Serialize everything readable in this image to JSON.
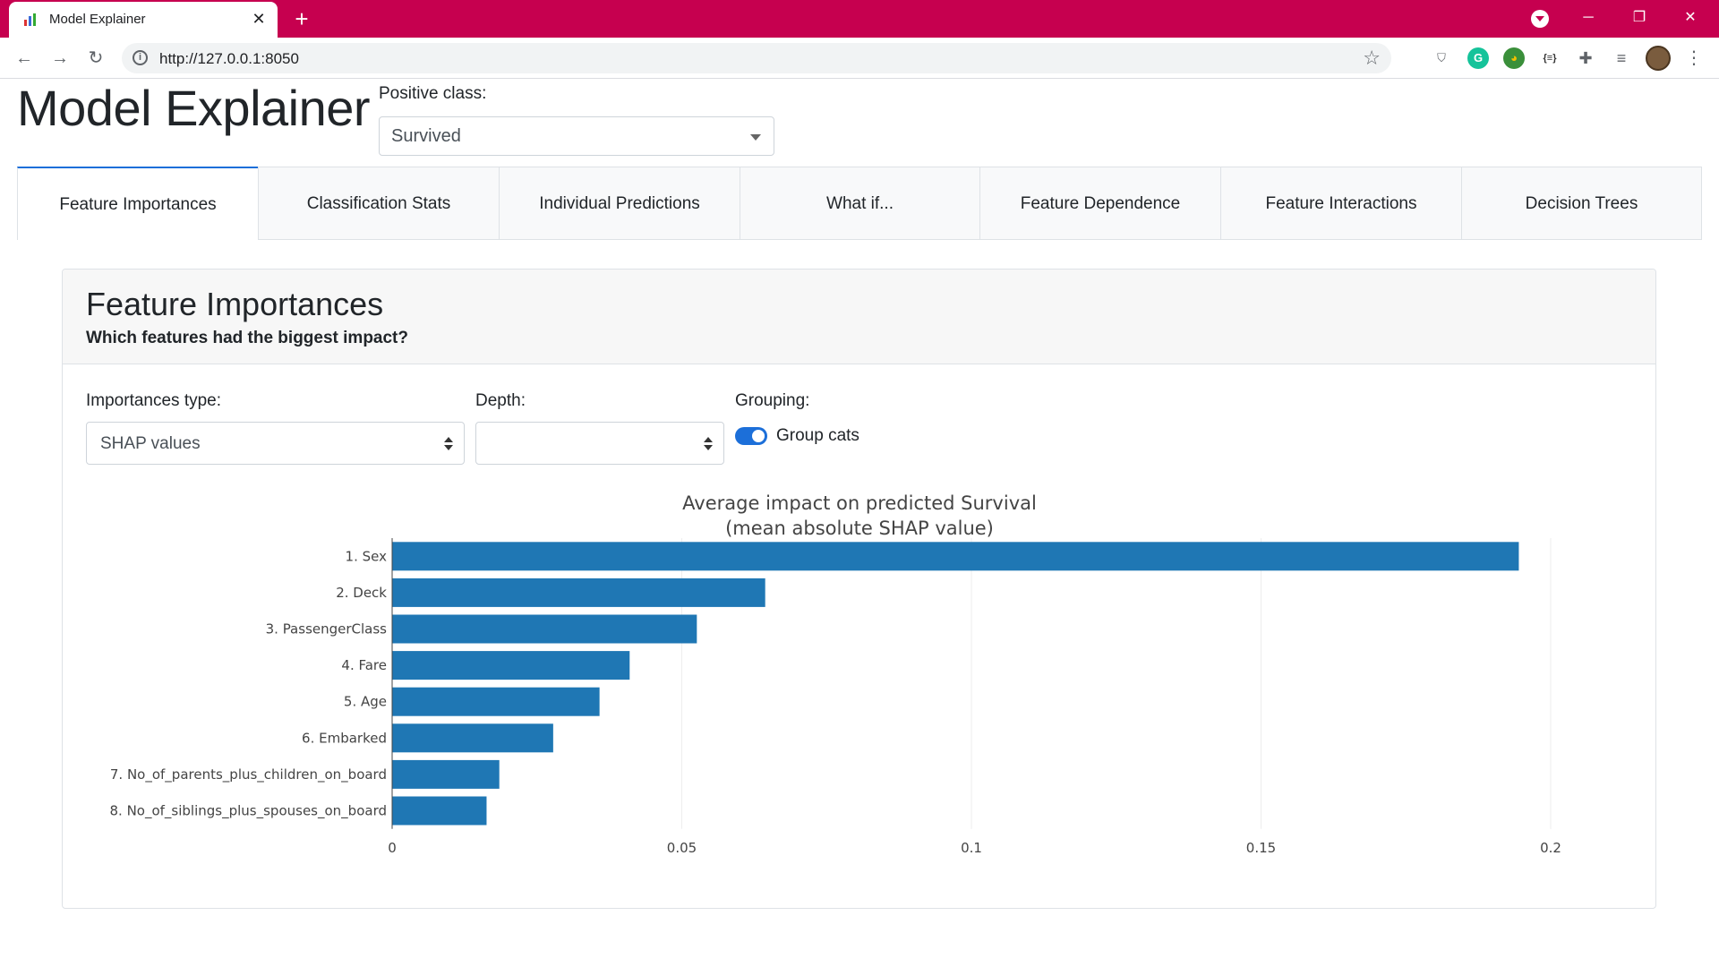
{
  "browser": {
    "tab_title": "Model Explainer",
    "tab_close": "✕",
    "new_tab": "+",
    "url": "http://127.0.0.1:8050",
    "window_controls": {
      "minimize": "─",
      "maximize": "❐",
      "close": "✕"
    },
    "accent": "#c6004f"
  },
  "header": {
    "title": "Model Explainer",
    "positive_class_label": "Positive class:",
    "positive_class_value": "Survived"
  },
  "tabs": [
    {
      "label": "Feature Importances",
      "active": true
    },
    {
      "label": "Classification Stats",
      "active": false
    },
    {
      "label": "Individual Predictions",
      "active": false
    },
    {
      "label": "What if...",
      "active": false
    },
    {
      "label": "Feature Dependence",
      "active": false
    },
    {
      "label": "Feature Interactions",
      "active": false
    },
    {
      "label": "Decision Trees",
      "active": false
    }
  ],
  "card": {
    "title": "Feature Importances",
    "subtitle": "Which features had the biggest impact?",
    "importances_label": "Importances type:",
    "importances_value": "SHAP values",
    "depth_label": "Depth:",
    "depth_value": "",
    "grouping_label": "Grouping:",
    "group_cats_label": "Group cats",
    "group_cats_on": true
  },
  "chart_data": {
    "type": "bar",
    "orientation": "horizontal",
    "title": "Average impact on predicted Survival",
    "subtitle": "(mean absolute SHAP value)",
    "categories": [
      "1. Sex",
      "2. Deck",
      "3. PassengerClass",
      "4. Fare",
      "5. Age",
      "6. Embarked",
      "7. No_of_parents_plus_children_on_board",
      "8. No_of_siblings_plus_spouses_on_board"
    ],
    "values": [
      0.1945,
      0.0644,
      0.0526,
      0.041,
      0.0358,
      0.0278,
      0.0185,
      0.0163
    ],
    "xlim": [
      0,
      0.2
    ],
    "xticks": [
      "0",
      "0.05",
      "0.1",
      "0.15",
      "0.2"
    ],
    "color": "#1f77b4",
    "grid": true
  }
}
